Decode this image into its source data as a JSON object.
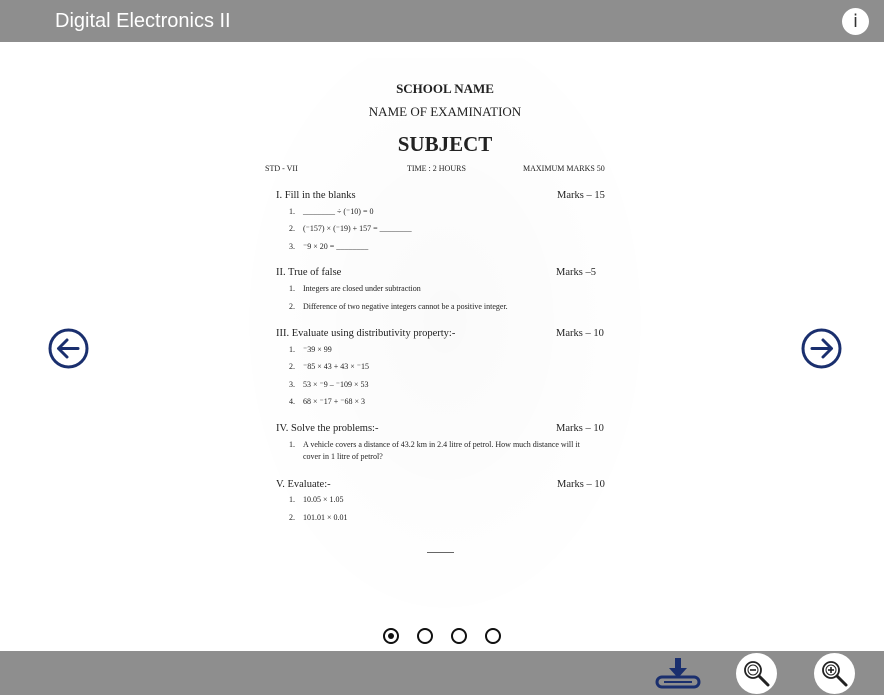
{
  "header": {
    "title": "Digital Electronics II",
    "info_icon": "info-icon",
    "info_label": "i"
  },
  "document": {
    "school": "SCHOOL NAME",
    "exam": "NAME OF EXAMINATION",
    "subject": "SUBJECT",
    "std": "STD - VII",
    "time": "TIME : 2 HOURS",
    "max_marks": "MAXIMUM MARKS 50",
    "sections": [
      {
        "title": "I. Fill in the blanks",
        "marks": "Marks – 15",
        "items": [
          {
            "num": "1.",
            "text": "________ ÷ (⁻10) = 0"
          },
          {
            "num": "2.",
            "text": "(⁻157) × (⁻19) + 157 = ________"
          },
          {
            "num": "3.",
            "text": "⁻9 × 20 = ________"
          }
        ]
      },
      {
        "title": "II. True of false",
        "marks": "Marks –5",
        "items": [
          {
            "num": "1.",
            "text": "Integers are closed under subtraction"
          },
          {
            "num": "2.",
            "text": "Difference of two negative integers cannot be a positive integer."
          }
        ]
      },
      {
        "title": "III. Evaluate using distributivity property:-",
        "marks": "Marks – 10",
        "items": [
          {
            "num": "1.",
            "text": "⁻39 × 99"
          },
          {
            "num": "2.",
            "text": "⁻85 × 43 + 43 × ⁻15"
          },
          {
            "num": "3.",
            "text": "53 × ⁻9 – ⁻109 × 53"
          },
          {
            "num": "4.",
            "text": "68 × ⁻17 + ⁻68 × 3"
          }
        ]
      },
      {
        "title": "IV. Solve the problems:-",
        "marks": "Marks – 10",
        "items": [
          {
            "num": "1.",
            "text": "A vehicle covers a distance of 43.2 km in 2.4 litre of petrol. How much distance will it cover in 1 litre of petrol?"
          }
        ]
      },
      {
        "title": "V. Evaluate:-",
        "marks": "Marks – 10",
        "items": [
          {
            "num": "1.",
            "text": "10.05 × 1.05"
          },
          {
            "num": "2.",
            "text": "101.01 × 0.01"
          }
        ]
      }
    ]
  },
  "navigation": {
    "prev_icon": "arrow-left-circle-icon",
    "next_icon": "arrow-right-circle-icon",
    "page_count": 4,
    "current_page": 1
  },
  "toolbar": {
    "download_icon": "download-icon",
    "zoom_out_icon": "zoom-out-icon",
    "zoom_in_icon": "zoom-in-icon"
  },
  "colors": {
    "bar_background": "#8e8e8e",
    "nav_arrow": "#1a2f6e",
    "download_icon": "#1a2f6e"
  }
}
